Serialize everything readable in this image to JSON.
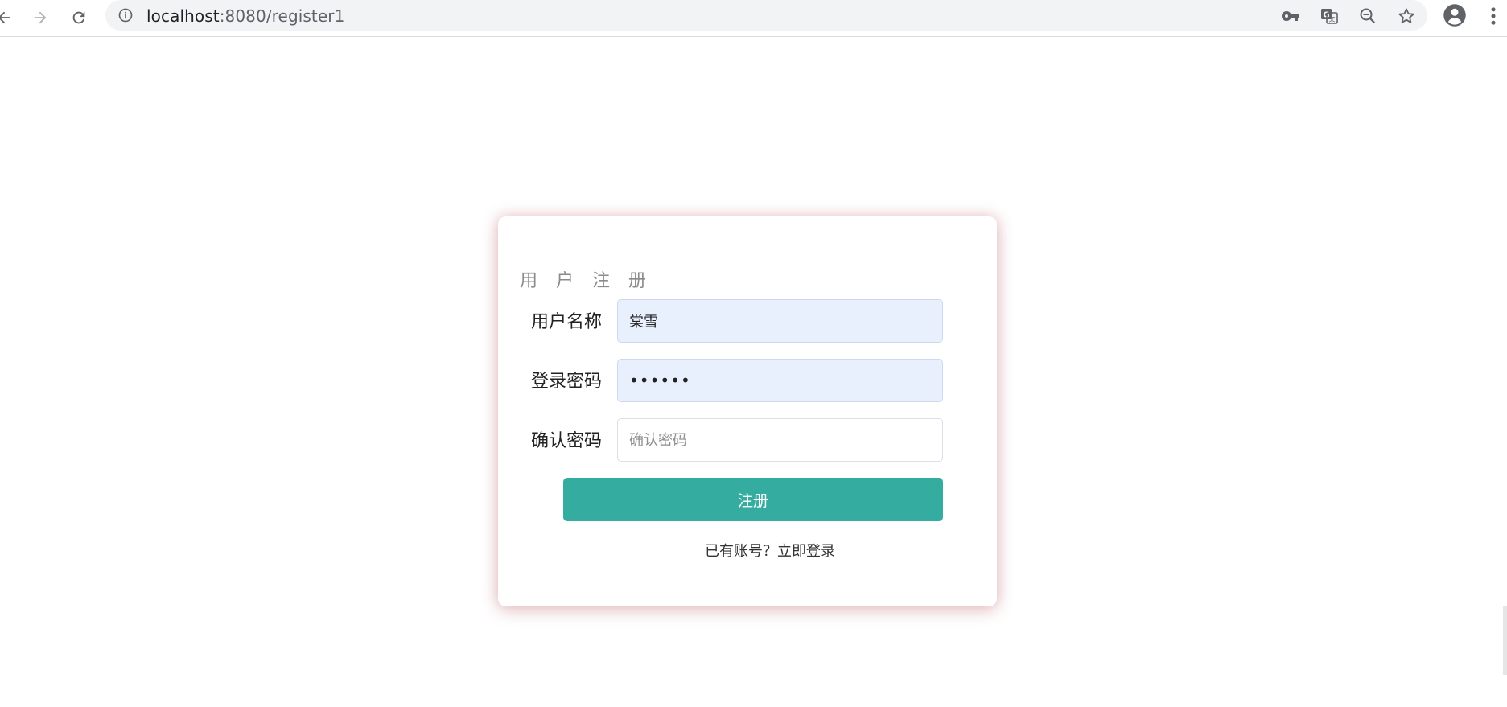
{
  "browser": {
    "url_host": "localhost",
    "url_rest": ":8080/register1"
  },
  "form": {
    "title": "用 户 注 册",
    "username": {
      "label": "用户名称",
      "value": "棠雪"
    },
    "password": {
      "label": "登录密码",
      "value": "••••••"
    },
    "confirm": {
      "label": "确认密码",
      "value": "",
      "placeholder": "确认密码"
    },
    "submit_label": "注册",
    "login_link": "已有账号？立即登录"
  },
  "colors": {
    "accent": "#35aca0",
    "autofill_bg": "#e8f0fe",
    "card_shadow": "#be5a64"
  },
  "icons": {
    "nav": [
      "back-arrow-icon",
      "forward-arrow-icon",
      "reload-icon"
    ],
    "omnibox": [
      "info-icon",
      "key-icon",
      "translate-icon",
      "zoom-out-icon",
      "star-icon"
    ],
    "toolbar": [
      "profile-icon",
      "menu-icon"
    ]
  }
}
